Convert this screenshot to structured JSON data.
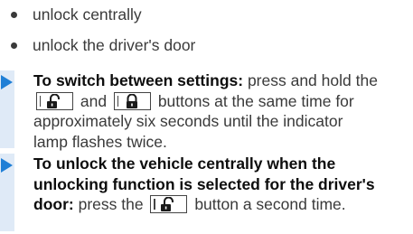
{
  "bullets": [
    {
      "text": "unlock centrally"
    },
    {
      "text": "unlock the driver's door"
    }
  ],
  "instructions": [
    {
      "title": "To switch between settings:",
      "t1": " press and hold the",
      "t2": "and",
      "t3": "buttons at the same time for",
      "line2": "approximately six seconds until the indicator",
      "line3": "lamp flashes twice."
    },
    {
      "title1": "To unlock the vehicle centrally when the",
      "title2": "unlocking function is selected for the driver's",
      "title3": "door:",
      "t1": " press the",
      "t2": " button a second time."
    }
  ],
  "icons": {
    "unlock": "unlock-icon",
    "lock": "lock-icon"
  },
  "colors": {
    "arrow": "#1f7fd6",
    "instruction_bar": "#dfeaf7",
    "text": "#3a3a3a",
    "bold_text": "#0d0d0d"
  }
}
